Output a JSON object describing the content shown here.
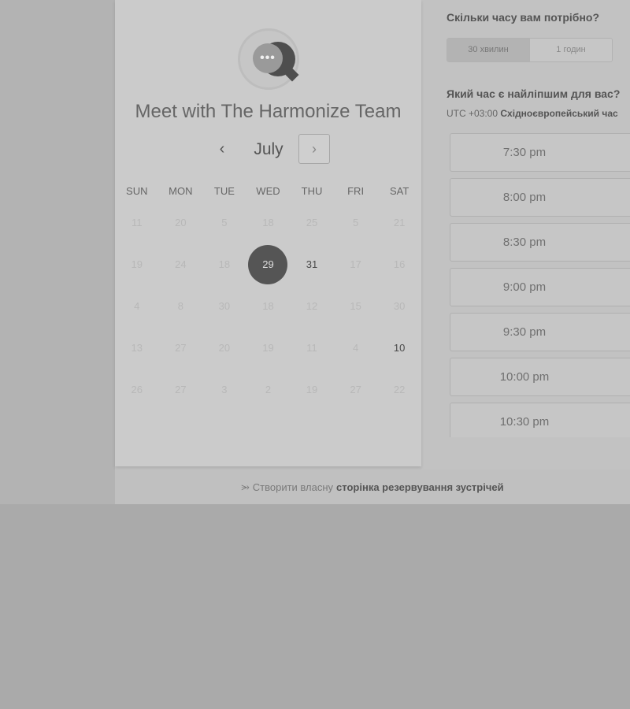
{
  "calendar": {
    "title": "Meet with The Harmonize Team",
    "avatar_text": "•••",
    "month": "July",
    "prev_icon": "‹",
    "next_icon": "›",
    "weekdays": [
      "SUN",
      "MON",
      "TUE",
      "WED",
      "THU",
      "FRI",
      "SAT"
    ],
    "weeks": [
      [
        {
          "d": "11"
        },
        {
          "d": "20"
        },
        {
          "d": "5"
        },
        {
          "d": "18"
        },
        {
          "d": "25"
        },
        {
          "d": "5"
        },
        {
          "d": "21"
        }
      ],
      [
        {
          "d": "19"
        },
        {
          "d": "24"
        },
        {
          "d": "18"
        },
        {
          "d": "29",
          "selected": true
        },
        {
          "d": "31",
          "available": true
        },
        {
          "d": "17"
        },
        {
          "d": "16"
        }
      ],
      [
        {
          "d": "4"
        },
        {
          "d": "8"
        },
        {
          "d": "30"
        },
        {
          "d": "18"
        },
        {
          "d": "12"
        },
        {
          "d": "15"
        },
        {
          "d": "30"
        }
      ],
      [
        {
          "d": "13"
        },
        {
          "d": "27"
        },
        {
          "d": "20"
        },
        {
          "d": "19"
        },
        {
          "d": "11"
        },
        {
          "d": "4"
        },
        {
          "d": "10",
          "available": true
        }
      ],
      [
        {
          "d": "26"
        },
        {
          "d": "27"
        },
        {
          "d": "3"
        },
        {
          "d": "2"
        },
        {
          "d": "19"
        },
        {
          "d": "27"
        },
        {
          "d": "22"
        }
      ]
    ]
  },
  "duration": {
    "question": "Скільки часу вам потрібно?",
    "options": [
      "30 хвилин",
      "1 годин"
    ],
    "selected_index": 0
  },
  "time": {
    "question": "Який час є найліпшим для вас?",
    "tz_prefix": "UTC +03:00",
    "tz_name": "Східноєвропейський час",
    "slots": [
      "7:30 pm",
      "8:00 pm",
      "8:30 pm",
      "9:00 pm",
      "9:30 pm",
      "10:00 pm",
      "10:30 pm"
    ]
  },
  "footer": {
    "icon": "hubspot-sprocket-icon",
    "prefix": "Створити власну",
    "link": "сторінка резервування зустрічей"
  }
}
